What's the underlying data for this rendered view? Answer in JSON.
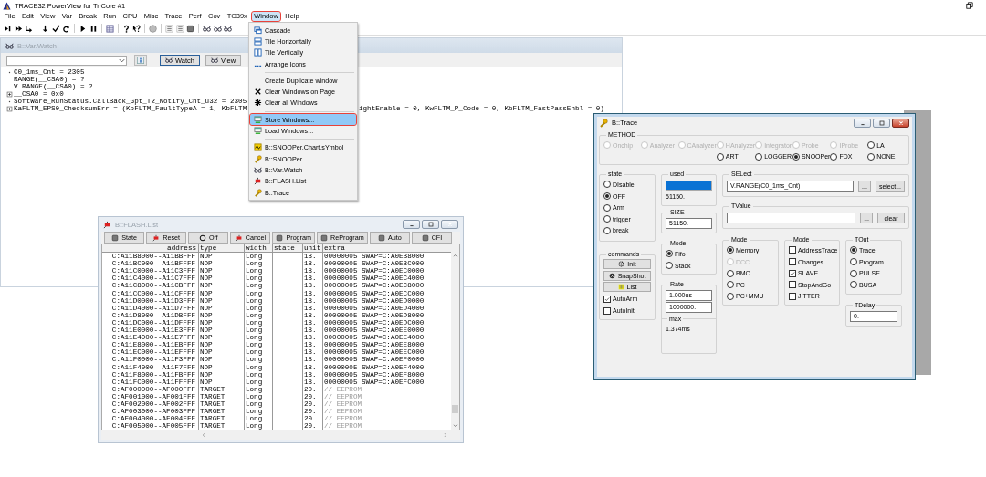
{
  "app": {
    "title": "TRACE32 PowerView for TriCore #1"
  },
  "menubar": [
    {
      "label": "File",
      "selected": false
    },
    {
      "label": "Edit",
      "selected": false
    },
    {
      "label": "View",
      "selected": false
    },
    {
      "label": "Var",
      "selected": false
    },
    {
      "label": "Break",
      "selected": false
    },
    {
      "label": "Run",
      "selected": false
    },
    {
      "label": "CPU",
      "selected": false
    },
    {
      "label": "Misc",
      "selected": false
    },
    {
      "label": "Trace",
      "selected": false
    },
    {
      "label": "Perf",
      "selected": false
    },
    {
      "label": "Cov",
      "selected": false
    },
    {
      "label": "TC39x",
      "selected": false
    },
    {
      "label": "Window",
      "selected": true
    },
    {
      "label": "Help",
      "selected": false
    }
  ],
  "var_watch": {
    "title": "B::Var.Watch",
    "buttons": [
      {
        "label": "Watch",
        "selected": true
      },
      {
        "label": "View",
        "selected": false
      }
    ],
    "lines": [
      {
        "kind": "dot",
        "text": "C0_1ms_Cnt = 2305"
      },
      {
        "kind": "plain",
        "text": "RANGE(__CSA0) = ?"
      },
      {
        "kind": "plain",
        "text": "V.RANGE(__CSA0) = ?"
      },
      {
        "kind": "expandable",
        "text": "__CSA0 = 0x0"
      },
      {
        "kind": "dot",
        "text": "SoftWare_RunStatus.CallBack_Gpt_T2_Notify_Cnt_u32 = 2305"
      },
      {
        "kind": "expandable",
        "text": "KaFLTM_EPS0_ChecksumErr = (KbFLTM_FaultTypeA = 1, KbFLTM",
        "continuation": "ightEnable = 0, KwFLTM_P_Code = 0, KbFLTM_FastPassEnbl = 0)"
      }
    ]
  },
  "window_menu": {
    "items": [
      {
        "kind": "item",
        "label": "Cascade",
        "selected": false
      },
      {
        "kind": "item",
        "label": "Tile Horizontally",
        "selected": false
      },
      {
        "kind": "item",
        "label": "Tile Vertically",
        "selected": false
      },
      {
        "kind": "item",
        "label": "Arrange Icons",
        "selected": false
      },
      {
        "kind": "separator"
      },
      {
        "kind": "item",
        "label": "Create Duplicate window",
        "selected": false
      },
      {
        "kind": "item",
        "label": "Clear Windows on Page",
        "selected": false
      },
      {
        "kind": "item",
        "label": "Clear all Windows",
        "selected": false
      },
      {
        "kind": "separator"
      },
      {
        "kind": "item",
        "label": "Store Windows...",
        "selected": true
      },
      {
        "kind": "item",
        "label": "Load Windows...",
        "selected": false
      },
      {
        "kind": "separator"
      },
      {
        "kind": "item",
        "label": "B::SNOOPer.Chart.sYmbol",
        "selected": false
      },
      {
        "kind": "item",
        "label": "B::SNOOPer",
        "selected": false
      },
      {
        "kind": "item",
        "label": "B::Var.Watch",
        "selected": false
      },
      {
        "kind": "item",
        "label": "B::FLASH.List",
        "selected": false
      },
      {
        "kind": "item",
        "label": "B::Trace",
        "selected": false
      }
    ]
  },
  "flash_list": {
    "title": "B::FLASH.List",
    "buttons": [
      "State",
      "Reset",
      "Off",
      "Cancel",
      "Program",
      "ReProgram",
      "Auto",
      "CFI"
    ],
    "columns": [
      "address",
      "type",
      "width",
      "state",
      "unit",
      "extra"
    ],
    "rows": [
      {
        "address": "C:A11B8000--A11BBFFF",
        "type": "NOP",
        "width": "Long",
        "unit": "18.",
        "extra": "00000005  SWAP=C:A0EB8000",
        "comment": false
      },
      {
        "address": "C:A11BC000--A11BFFFF",
        "type": "NOP",
        "width": "Long",
        "unit": "18.",
        "extra": "00000005  SWAP=C:A0EBC000",
        "comment": false
      },
      {
        "address": "C:A11C0000--A11C3FFF",
        "type": "NOP",
        "width": "Long",
        "unit": "18.",
        "extra": "00000005  SWAP=C:A0EC0000",
        "comment": false
      },
      {
        "address": "C:A11C4000--A11C7FFF",
        "type": "NOP",
        "width": "Long",
        "unit": "18.",
        "extra": "00000005  SWAP=C:A0EC4000",
        "comment": false
      },
      {
        "address": "C:A11C8000--A11CBFFF",
        "type": "NOP",
        "width": "Long",
        "unit": "18.",
        "extra": "00000005  SWAP=C:A0EC8000",
        "comment": false
      },
      {
        "address": "C:A11CC000--A11CFFFF",
        "type": "NOP",
        "width": "Long",
        "unit": "18.",
        "extra": "00000005  SWAP=C:A0ECC000",
        "comment": false
      },
      {
        "address": "C:A11D0000--A11D3FFF",
        "type": "NOP",
        "width": "Long",
        "unit": "18.",
        "extra": "00000005  SWAP=C:A0ED0000",
        "comment": false
      },
      {
        "address": "C:A11D4000--A11D7FFF",
        "type": "NOP",
        "width": "Long",
        "unit": "18.",
        "extra": "00000005  SWAP=C:A0ED4000",
        "comment": false
      },
      {
        "address": "C:A11D8000--A11DBFFF",
        "type": "NOP",
        "width": "Long",
        "unit": "18.",
        "extra": "00000005  SWAP=C:A0ED8000",
        "comment": false
      },
      {
        "address": "C:A11DC000--A11DFFFF",
        "type": "NOP",
        "width": "Long",
        "unit": "18.",
        "extra": "00000005  SWAP=C:A0EDC000",
        "comment": false
      },
      {
        "address": "C:A11E0000--A11E3FFF",
        "type": "NOP",
        "width": "Long",
        "unit": "18.",
        "extra": "00000005  SWAP=C:A0EE0000",
        "comment": false
      },
      {
        "address": "C:A11E4000--A11E7FFF",
        "type": "NOP",
        "width": "Long",
        "unit": "18.",
        "extra": "00000005  SWAP=C:A0EE4000",
        "comment": false
      },
      {
        "address": "C:A11E8000--A11EBFFF",
        "type": "NOP",
        "width": "Long",
        "unit": "18.",
        "extra": "00000005  SWAP=C:A0EE8000",
        "comment": false
      },
      {
        "address": "C:A11EC000--A11EFFFF",
        "type": "NOP",
        "width": "Long",
        "unit": "18.",
        "extra": "00000005  SWAP=C:A0EEC000",
        "comment": false
      },
      {
        "address": "C:A11F0000--A11F3FFF",
        "type": "NOP",
        "width": "Long",
        "unit": "18.",
        "extra": "00000005  SWAP=C:A0EF0000",
        "comment": false
      },
      {
        "address": "C:A11F4000--A11F7FFF",
        "type": "NOP",
        "width": "Long",
        "unit": "18.",
        "extra": "00000005  SWAP=C:A0EF4000",
        "comment": false
      },
      {
        "address": "C:A11F8000--A11FBFFF",
        "type": "NOP",
        "width": "Long",
        "unit": "18.",
        "extra": "00000005  SWAP=C:A0EF8000",
        "comment": false
      },
      {
        "address": "C:A11FC000--A11FFFFF",
        "type": "NOP",
        "width": "Long",
        "unit": "18.",
        "extra": "00000005  SWAP=C:A0EFC000",
        "comment": false
      },
      {
        "address": "C:AF000000--AF000FFF",
        "type": "TARGET",
        "width": "Long",
        "unit": "20.",
        "extra": "// EEPROM",
        "comment": true
      },
      {
        "address": "C:AF001000--AF001FFF",
        "type": "TARGET",
        "width": "Long",
        "unit": "20.",
        "extra": "// EEPROM",
        "comment": true
      },
      {
        "address": "C:AF002000--AF002FFF",
        "type": "TARGET",
        "width": "Long",
        "unit": "20.",
        "extra": "// EEPROM",
        "comment": true
      },
      {
        "address": "C:AF003000--AF003FFF",
        "type": "TARGET",
        "width": "Long",
        "unit": "20.",
        "extra": "// EEPROM",
        "comment": true
      },
      {
        "address": "C:AF004000--AF004FFF",
        "type": "TARGET",
        "width": "Long",
        "unit": "20.",
        "extra": "// EEPROM",
        "comment": true
      },
      {
        "address": "C:AF005000--AF005FFF",
        "type": "TARGET",
        "width": "Long",
        "unit": "20.",
        "extra": "// EEPROM",
        "comment": true
      }
    ]
  },
  "trace": {
    "title": "B::Trace",
    "method": {
      "label": "METHOD",
      "row_1": [
        {
          "label": "Onchip",
          "selected": false,
          "disabled": true
        },
        {
          "label": "Analyzer",
          "selected": false,
          "disabled": true
        },
        {
          "label": "CAnalyzer",
          "selected": false,
          "disabled": true
        },
        {
          "label": "HAnalyzer",
          "selected": false,
          "disabled": true
        },
        {
          "label": "Integrator",
          "selected": false,
          "disabled": true
        },
        {
          "label": "Probe",
          "selected": false,
          "disabled": true
        },
        {
          "label": "IProbe",
          "selected": false,
          "disabled": true
        },
        {
          "label": "LA",
          "selected": false,
          "disabled": false
        }
      ],
      "row_2": [
        {
          "label": "ART",
          "selected": false,
          "disabled": false
        },
        {
          "label": "LOGGER",
          "selected": false,
          "disabled": false
        },
        {
          "label": "SNOOPer",
          "selected": true,
          "disabled": false
        },
        {
          "label": "FDX",
          "selected": false,
          "disabled": false
        },
        {
          "label": "NONE",
          "selected": false,
          "disabled": false
        }
      ]
    },
    "state": {
      "label": "state",
      "options": [
        {
          "label": "DIsable",
          "selected": false
        },
        {
          "label": "OFF",
          "selected": true
        },
        {
          "label": "Arm",
          "selected": false
        },
        {
          "label": "trigger",
          "selected": false
        },
        {
          "label": "break",
          "selected": false
        }
      ]
    },
    "used": {
      "label": "used",
      "level": 1,
      "value": "51150."
    },
    "size": {
      "label": "SIZE",
      "value": "51150."
    },
    "select": {
      "label": "SELect",
      "value": "V.RANGE(C0_1ms_Cnt)",
      "buttons": [
        "...",
        "select..."
      ]
    },
    "tvalue": {
      "label": "TValue",
      "buttons": [
        "...",
        "clear"
      ]
    },
    "commands": {
      "label": "commands",
      "buttons": [
        "Init",
        "SnapShot",
        "List"
      ],
      "checks": [
        {
          "label": "AutoArm",
          "checked": true
        },
        {
          "label": "AutoInit",
          "checked": false
        }
      ]
    },
    "mode_1": {
      "label": "Mode",
      "options": [
        {
          "label": "Fifo",
          "selected": true
        },
        {
          "label": "Stack",
          "selected": false
        }
      ]
    },
    "rate": {
      "label": "Rate",
      "values": [
        "1.000us",
        "1000000."
      ],
      "max_label": "max",
      "max": "1.374ms"
    },
    "mode_2": {
      "label": "Mode",
      "options": [
        {
          "label": "Memory",
          "selected": true,
          "disabled": false
        },
        {
          "label": "DCC",
          "selected": false,
          "disabled": true
        },
        {
          "label": "BMC",
          "selected": false,
          "disabled": false
        },
        {
          "label": "PC",
          "selected": false,
          "disabled": false
        },
        {
          "label": "PC+MMU",
          "selected": false,
          "disabled": false
        }
      ]
    },
    "mode_3": {
      "label": "Mode",
      "checks": [
        {
          "label": "AddressTrace",
          "checked": false
        },
        {
          "label": "Changes",
          "checked": false
        },
        {
          "label": "SLAVE",
          "checked": true
        },
        {
          "label": "StopAndGo",
          "checked": false
        },
        {
          "label": "JITTER",
          "checked": false
        }
      ]
    },
    "tout": {
      "label": "TOut",
      "options": [
        {
          "label": "Trace",
          "selected": true
        },
        {
          "label": "Program",
          "selected": false
        },
        {
          "label": "PULSE",
          "selected": false
        },
        {
          "label": "BUSA",
          "selected": false
        }
      ]
    },
    "tdelay": {
      "label": "TDelay",
      "value": "0."
    }
  }
}
